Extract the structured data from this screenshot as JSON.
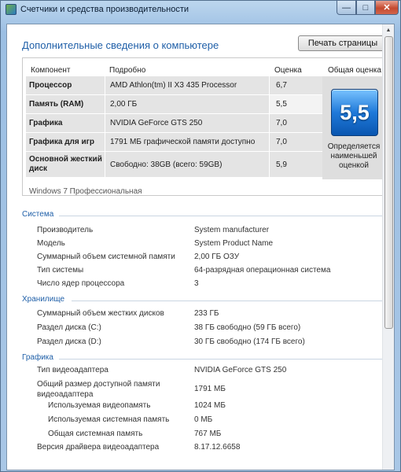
{
  "window": {
    "title": "Счетчики и средства производительности"
  },
  "titlebar": {
    "minimize": "—",
    "maximize": "□",
    "close": "✕"
  },
  "page": {
    "heading": "Дополнительные сведения о компьютере",
    "print_button": "Печать страницы"
  },
  "scores": {
    "headers": {
      "component": "Компонент",
      "details": "Подробно",
      "score": "Оценка",
      "base": "Общая оценка"
    },
    "rows": [
      {
        "component": "Процессор",
        "details": "AMD Athlon(tm) II X3 435 Processor",
        "score": "6,7"
      },
      {
        "component": "Память (RAM)",
        "details": "2,00 ГБ",
        "score": "5,5"
      },
      {
        "component": "Графика",
        "details": "NVIDIA GeForce GTS 250",
        "score": "7,0"
      },
      {
        "component": "Графика для игр",
        "details": "1791 МБ графической памяти доступно",
        "score": "7,0"
      },
      {
        "component": "Основной жесткий диск",
        "details": "Свободно: 38GB (всего: 59GB)",
        "score": "5,9"
      }
    ],
    "base_score": "5,5",
    "base_note": "Определяется наименьшей оценкой",
    "edition": "Windows 7 Профессиональная"
  },
  "sections": {
    "system": {
      "title": "Система",
      "items": [
        {
          "label": "Производитель",
          "value": "System manufacturer"
        },
        {
          "label": "Модель",
          "value": "System Product Name"
        },
        {
          "label": "Суммарный объем системной памяти",
          "value": "2,00 ГБ ОЗУ"
        },
        {
          "label": "Тип системы",
          "value": "64-разрядная операционная система"
        },
        {
          "label": "Число ядер процессора",
          "value": "3"
        }
      ]
    },
    "storage": {
      "title": "Хранилище",
      "items": [
        {
          "label": "Суммарный объем жестких дисков",
          "value": "233 ГБ"
        },
        {
          "label": "Раздел диска (C:)",
          "value": "38 ГБ свободно (59 ГБ всего)"
        },
        {
          "label": "Раздел диска (D:)",
          "value": "30 ГБ свободно (174 ГБ всего)"
        }
      ]
    },
    "graphics": {
      "title": "Графика",
      "items": [
        {
          "label": "Тип видеоадаптера",
          "value": "NVIDIA GeForce GTS 250"
        },
        {
          "label": "Общий размер доступной памяти видеоадаптера",
          "value": "1791 МБ"
        },
        {
          "label": "Используемая видеопамять",
          "value": "1024 МБ"
        },
        {
          "label": "Используемая системная память",
          "value": "0 МБ"
        },
        {
          "label": "Общая системная память",
          "value": "767 МБ"
        },
        {
          "label": "Версия драйвера видеоадаптера",
          "value": "8.17.12.6658"
        }
      ]
    }
  },
  "colors": {
    "accent": "#1f5fa8",
    "row_bg": "#e4e4e4",
    "badge": "#1f79d9"
  },
  "icons": [
    "app-icon",
    "minimize-icon",
    "maximize-icon",
    "close-icon",
    "scroll-up-icon"
  ]
}
